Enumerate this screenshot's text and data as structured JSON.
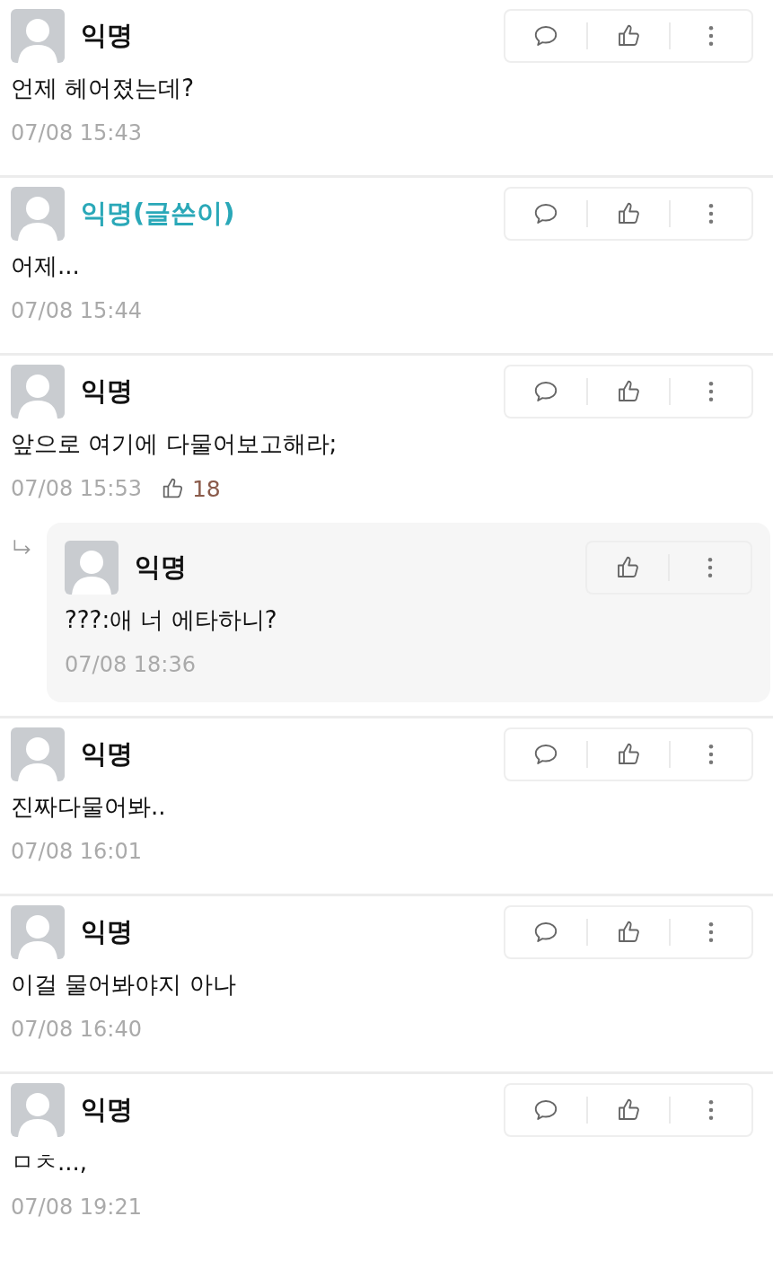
{
  "comments": [
    {
      "author": "익명",
      "is_writer": false,
      "body": "언제 헤어졌는데?",
      "time": "07/08 15:43"
    },
    {
      "author": "익명(글쓴이)",
      "is_writer": true,
      "body": "어제...",
      "time": "07/08 15:44"
    },
    {
      "author": "익명",
      "is_writer": false,
      "body": "앞으로 여기에 다물어보고해라;",
      "time": "07/08 15:53",
      "likes": "18",
      "replies": [
        {
          "author": "익명",
          "is_writer": false,
          "body": "???:애 너 에타하니?",
          "time": "07/08 18:36"
        }
      ]
    },
    {
      "author": "익명",
      "is_writer": false,
      "body": "진짜다물어봐..",
      "time": "07/08 16:01"
    },
    {
      "author": "익명",
      "is_writer": false,
      "body": "이걸 물어봐야지 아나",
      "time": "07/08 16:40"
    },
    {
      "author": "익명",
      "is_writer": false,
      "body": "ㅁㅊ...,",
      "time": "07/08 19:21"
    }
  ]
}
